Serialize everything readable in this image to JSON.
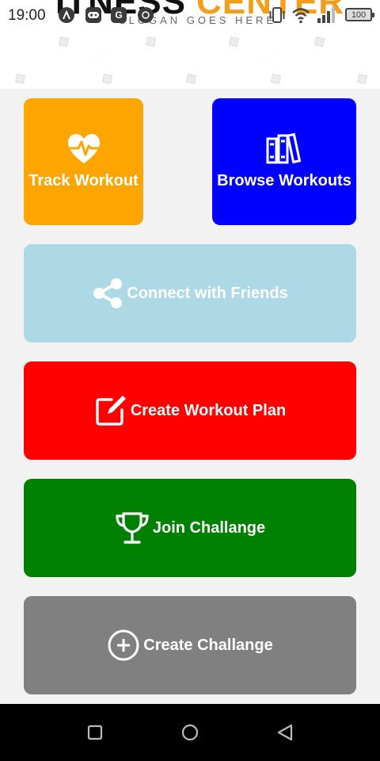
{
  "status_bar": {
    "time": "19:00",
    "battery": "100"
  },
  "header": {
    "title_main": "ITNESS",
    "title_accent": "CENTER",
    "slogan": "SLOGAN GOES HERE"
  },
  "tiles": [
    {
      "label": "Track Workout",
      "color": "#ffa500",
      "icon": "heart-pulse-icon"
    },
    {
      "label": "Browse Workouts",
      "color": "#0000ff",
      "icon": "books-icon"
    },
    {
      "label": "Connect with Friends",
      "color": "#add8e6",
      "icon": "share-icon"
    },
    {
      "label": "Create Workout Plan",
      "color": "#ff0000",
      "icon": "edit-icon"
    },
    {
      "label": "Join Challange",
      "color": "#008000",
      "icon": "trophy-icon"
    },
    {
      "label": "Create Challange",
      "color": "#808080",
      "icon": "plus-circle-icon"
    }
  ],
  "nav": {
    "buttons": [
      "recents-icon",
      "home-icon",
      "back-icon"
    ]
  }
}
